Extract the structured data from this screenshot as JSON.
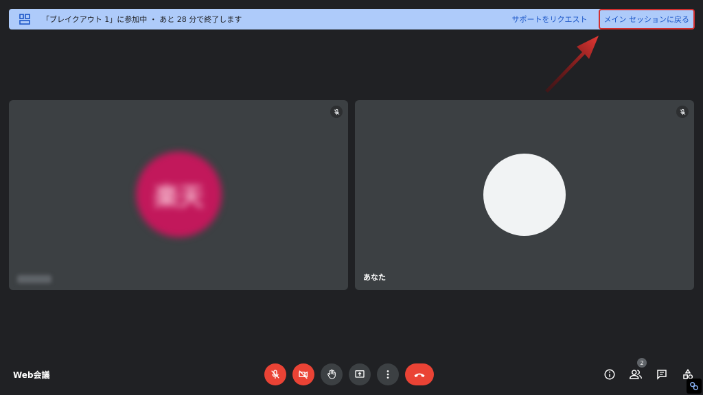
{
  "banner": {
    "message": "「ブレイクアウト 1」に参加中 ・ あと 28 分で終了します",
    "support_label": "サポートをリクエスト",
    "return_label": "メイン セッションに戻る"
  },
  "tiles": [
    {
      "avatar_text": "楽天",
      "name": ""
    },
    {
      "name": "あなた"
    }
  ],
  "meeting": {
    "name": "Web会議"
  },
  "toolbar": {
    "participants_count": "2"
  },
  "icons": {
    "breakout": "breakout-room-icon",
    "mic_off": "mic-off-icon",
    "cam_off": "camera-off-icon",
    "hand": "raise-hand-icon",
    "present": "present-screen-icon",
    "more": "more-options-icon",
    "hangup": "hang-up-icon",
    "info": "info-icon",
    "people": "people-icon",
    "chat": "chat-icon",
    "activities": "activities-icon"
  },
  "colors": {
    "banner": "#aecbfa",
    "tile": "#3c4043",
    "red": "#ea4335",
    "highlight": "#d32f2f"
  }
}
